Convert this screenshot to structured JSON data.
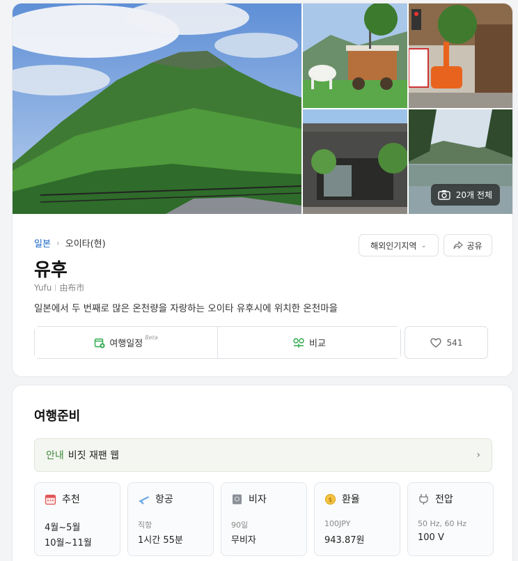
{
  "gallery": {
    "photo_count_label": "20개 전체"
  },
  "breadcrumb": {
    "country": "일본",
    "region": "오이타(현)"
  },
  "region_button": {
    "label": "해외인기지역"
  },
  "share_button": {
    "label": "공유"
  },
  "destination": {
    "title": "유후",
    "romanized": "Yufu",
    "native": "由布市",
    "description": "일본에서 두 번째로 많은 온천량을 자랑하는 오이타 유후시에 위치한 온천마을"
  },
  "actions": {
    "itinerary": "여행일정",
    "itinerary_badge": "Beta",
    "compare": "비교",
    "like_count": "541"
  },
  "prep": {
    "title": "여행준비",
    "guide_tag": "안내",
    "guide_label": "비짓 재팬 웹",
    "cards": [
      {
        "icon": "calendar-icon",
        "label": "추천",
        "sub": "",
        "line1": "4월~5월",
        "line2": "10월~11월"
      },
      {
        "icon": "airplane-icon",
        "label": "항공",
        "sub": "직항",
        "line1": "1시간 55분",
        "line2": ""
      },
      {
        "icon": "passport-icon",
        "label": "비자",
        "sub": "90일",
        "line1": "무비자",
        "line2": ""
      },
      {
        "icon": "currency-icon",
        "label": "환율",
        "sub": "100JPY",
        "line1": "943.87원",
        "line2": ""
      },
      {
        "icon": "plug-icon",
        "label": "전압",
        "sub": "50 Hz, 60 Hz",
        "line1": "100 V",
        "line2": ""
      }
    ]
  }
}
